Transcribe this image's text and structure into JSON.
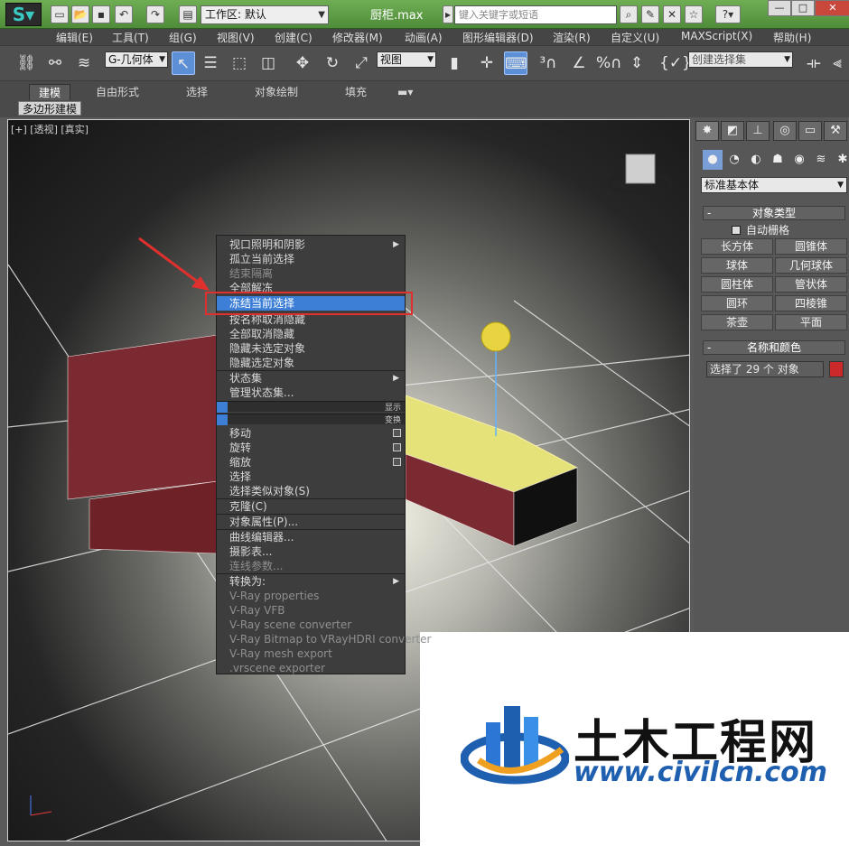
{
  "titlebar": {
    "workspace_label": "工作区: 默认",
    "file_title": "厨柜.max",
    "search_placeholder": "键入关键字或短语"
  },
  "menubar": {
    "items": [
      "编辑(E)",
      "工具(T)",
      "组(G)",
      "视图(V)",
      "创建(C)",
      "修改器(M)",
      "动画(A)",
      "图形编辑器(D)",
      "渲染(R)",
      "自定义(U)",
      "MAXScript(X)",
      "帮助(H)"
    ]
  },
  "toolbar": {
    "filter_value": "G-几何体",
    "ref_coord_value": "视图",
    "selection_set_placeholder": "创建选择集"
  },
  "ribbon": {
    "tabs": [
      "建模",
      "自由形式",
      "选择",
      "对象绘制",
      "填充"
    ],
    "sub_label": "多边形建模"
  },
  "viewport": {
    "label": "[+] [透视] [真实]"
  },
  "cmdpanel": {
    "category_value": "标准基本体",
    "object_type_header": "对象类型",
    "auto_grid_label": "自动栅格",
    "object_buttons": [
      "长方体",
      "圆锥体",
      "球体",
      "几何球体",
      "圆柱体",
      "管状体",
      "圆环",
      "四棱锥",
      "茶壶",
      "平面"
    ],
    "name_color_header": "名称和颜色",
    "name_field_value": "选择了 29 个 对象",
    "object_color": "#cc2a2a"
  },
  "context_menu": {
    "items": [
      {
        "label": "视口照明和阴影",
        "submenu": true,
        "disabled": false
      },
      {
        "label": "孤立当前选择",
        "disabled": false
      },
      {
        "label": "结束隔离",
        "disabled": true
      },
      {
        "label": "全部解冻",
        "disabled": false
      },
      {
        "label": "冻结当前选择",
        "disabled": false,
        "highlight": true
      },
      {
        "label": "按名称取消隐藏",
        "disabled": false
      },
      {
        "label": "全部取消隐藏",
        "disabled": false
      },
      {
        "label": "隐藏未选定对象",
        "disabled": false
      },
      {
        "label": "隐藏选定对象",
        "disabled": false
      },
      {
        "label": "状态集",
        "submenu": true,
        "disabled": false
      },
      {
        "label": "管理状态集...",
        "disabled": false
      }
    ],
    "bar_display": "显示",
    "bar_transform": "变换",
    "transform_items": [
      {
        "label": "移动",
        "box": true
      },
      {
        "label": "旋转",
        "box": true
      },
      {
        "label": "缩放",
        "box": true
      },
      {
        "label": "选择"
      },
      {
        "label": "选择类似对象(S)"
      }
    ],
    "clone": "克隆(C)",
    "object_props": "对象属性(P)...",
    "editors": [
      "曲线编辑器...",
      "摄影表...",
      "连线参数..."
    ],
    "convert_to": "转换为:",
    "vray_items": [
      "V-Ray properties",
      "V-Ray VFB",
      "V-Ray scene converter",
      "V-Ray Bitmap to VRayHDRI converter",
      "V-Ray mesh export",
      ".vrscene exporter"
    ]
  },
  "watermark": {
    "name": "土木工程网",
    "url": "www.civilcn.com"
  }
}
